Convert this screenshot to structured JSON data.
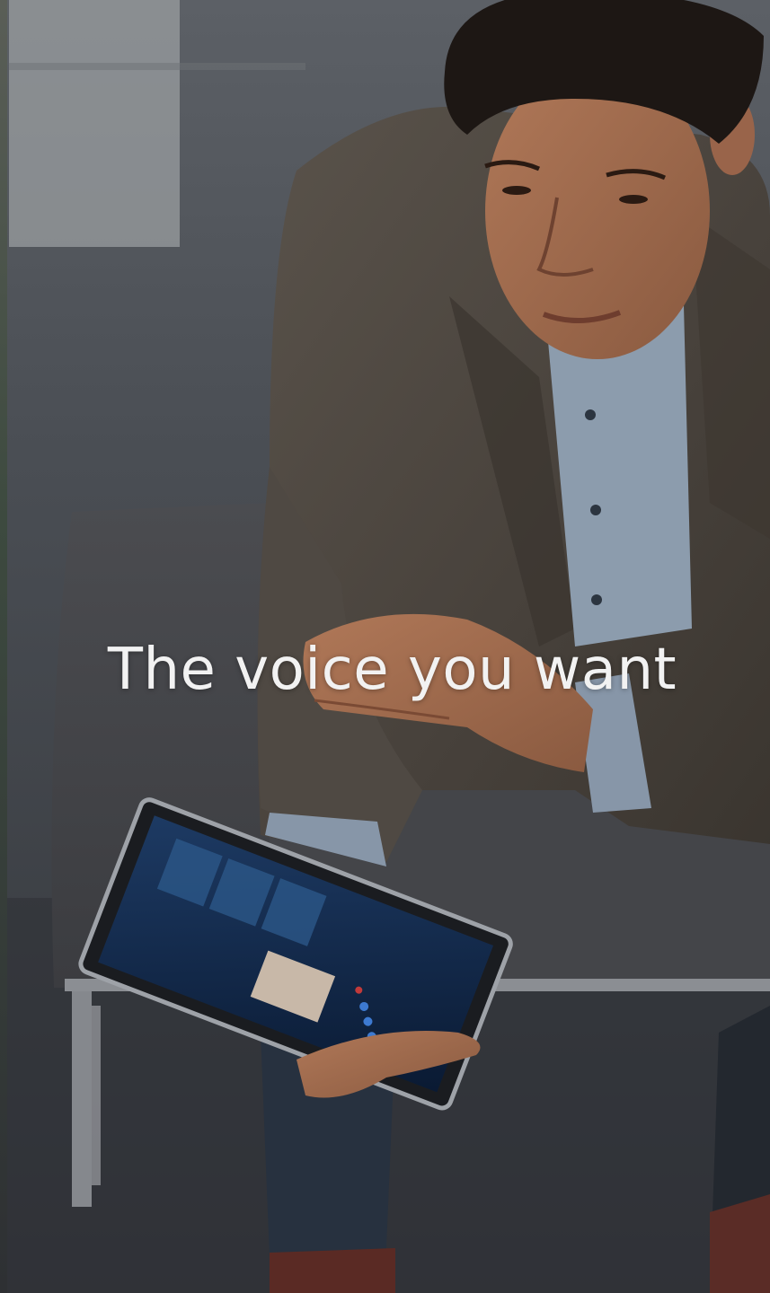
{
  "hero": {
    "headline": "The voice you want",
    "image_description_icon": "person-with-tablet-photo",
    "colors": {
      "headline_text": "#f2f2f2",
      "carpet": "#3d4046",
      "jacket": "#4a4540",
      "shirt": "#8a9aab",
      "tablet_screen": "#0f2440"
    }
  }
}
